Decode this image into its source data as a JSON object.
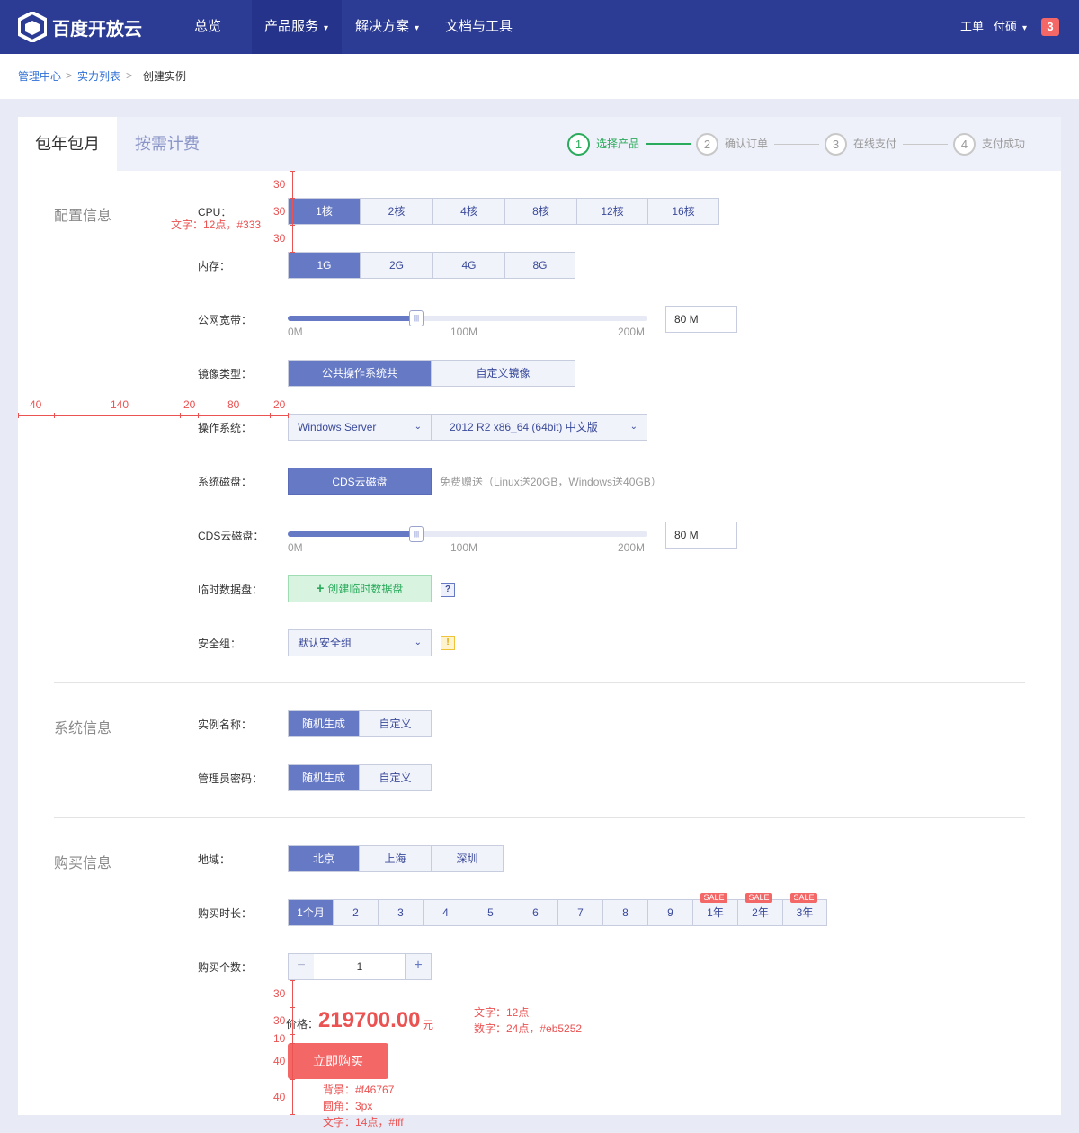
{
  "brand": {
    "logo_text": "百度开放云"
  },
  "nav": {
    "items": [
      {
        "label": "总览"
      },
      {
        "label": "产品服务",
        "caret": "▾"
      },
      {
        "label": "解决方案",
        "caret": "▾"
      },
      {
        "label": "文档与工具"
      }
    ],
    "right": {
      "ticket": "工单",
      "user": "付硕",
      "user_caret": "▾",
      "badge": "3"
    }
  },
  "breadcrumb": {
    "items": [
      "管理中心",
      "实力列表",
      "创建实例"
    ],
    "sep": ">"
  },
  "tabs": {
    "yearly": "包年包月",
    "ondemand": "按需计费"
  },
  "steps": [
    {
      "num": "1",
      "label": "选择产品"
    },
    {
      "num": "2",
      "label": "确认订单"
    },
    {
      "num": "3",
      "label": "在线支付"
    },
    {
      "num": "4",
      "label": "支付成功"
    }
  ],
  "config": {
    "title": "配置信息",
    "cpu": {
      "label": "CPU：",
      "options": [
        "1核",
        "2核",
        "4核",
        "8核",
        "12核",
        "16核"
      ],
      "selected": "1核"
    },
    "memory": {
      "label": "内存：",
      "options": [
        "1G",
        "2G",
        "4G",
        "8G"
      ],
      "selected": "1G"
    },
    "bandwidth": {
      "label": "公网宽带：",
      "ticks": [
        "0M",
        "100M",
        "200M"
      ],
      "value": "80 M",
      "slider_fraction": 0.36
    },
    "image_type": {
      "label": "镜像类型：",
      "options": [
        "公共操作系统共",
        "自定义镜像"
      ],
      "selected": "公共操作系统共"
    },
    "os": {
      "label": "操作系统：",
      "os_value": "Windows Server",
      "version_value": "2012 R2 x86_64 (64bit) 中文版"
    },
    "system_disk": {
      "label": "系统磁盘：",
      "button": "CDS云磁盘",
      "note": "免费赠送（Linux送20GB，Windows送40GB）"
    },
    "cds": {
      "label": "CDS云磁盘：",
      "ticks": [
        "0M",
        "100M",
        "200M"
      ],
      "value": "80 M",
      "slider_fraction": 0.36
    },
    "temp_disk": {
      "label": "临时数据盘：",
      "button": "创建临时数据盘",
      "plus": "+",
      "help": "?"
    },
    "security_group": {
      "label": "安全组：",
      "value": "默认安全组",
      "warn": "!"
    }
  },
  "system": {
    "title": "系统信息",
    "instance_name": {
      "label": "实例名称：",
      "options": [
        "随机生成",
        "自定义"
      ],
      "selected": "随机生成"
    },
    "admin_password": {
      "label": "管理员密码：",
      "options": [
        "随机生成",
        "自定义"
      ],
      "selected": "随机生成"
    }
  },
  "purchase": {
    "title": "购买信息",
    "region": {
      "label": "地域：",
      "options": [
        "北京",
        "上海",
        "深圳"
      ],
      "selected": "北京"
    },
    "duration": {
      "label": "购买时长：",
      "options": [
        "1个月",
        "2",
        "3",
        "4",
        "5",
        "6",
        "7",
        "8",
        "9",
        "1年",
        "2年",
        "3年"
      ],
      "selected": "1个月",
      "sale_tag": "SALE"
    },
    "quantity": {
      "label": "购买个数：",
      "minus": "−",
      "plus": "+",
      "value": "1"
    },
    "price": {
      "label": "价格：",
      "value": "219700.00",
      "unit": "元"
    },
    "buy_button": "立即购买"
  },
  "annotations": {
    "cpu_top": "30",
    "cpu_mid": "30",
    "cpu_bottom": "30",
    "cpu_text": "文字：12点，#333",
    "h_spacing": [
      "40",
      "140",
      "20",
      "80",
      "20"
    ],
    "price_gaps": [
      "30",
      "30",
      "10",
      "40",
      "40"
    ],
    "price_text_1": "文字：12点",
    "price_text_2": "数字：24点，#eb5252",
    "btn_spec": [
      "背景：#f46767",
      "圆角：3px",
      "文字：14点，#fff"
    ]
  },
  "colors": {
    "nav_bg": "#2c3b93",
    "primary": "#6679c5",
    "success": "#2aaa5b",
    "price": "#eb5252",
    "buy_bg": "#f46767"
  }
}
